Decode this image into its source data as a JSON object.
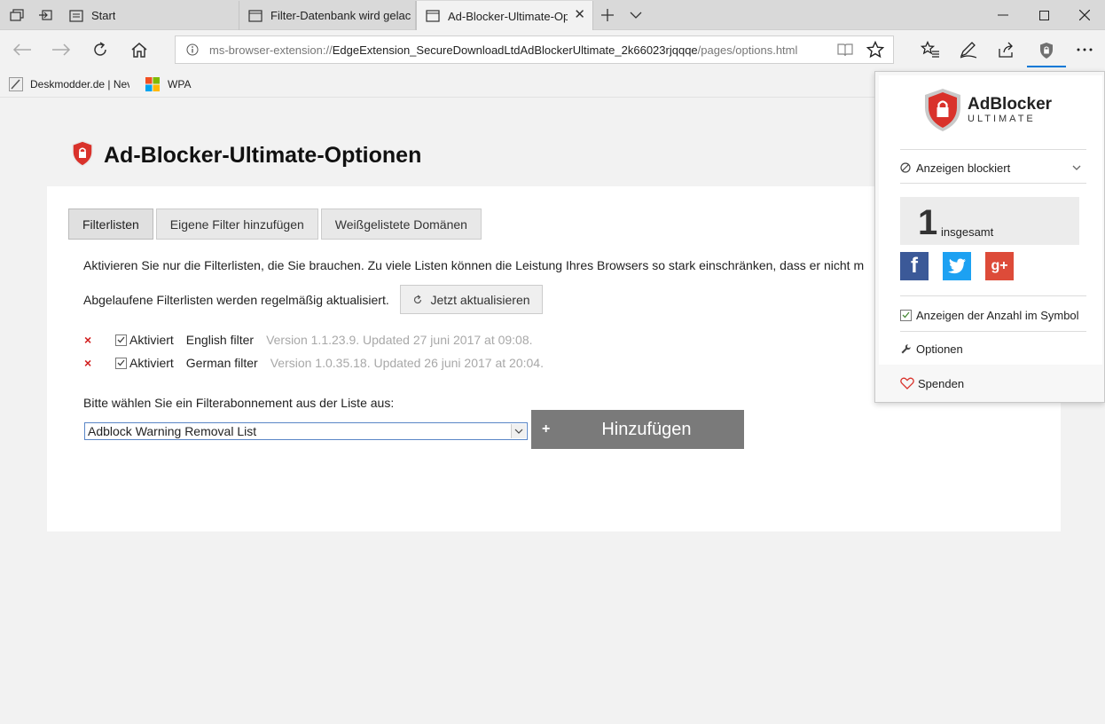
{
  "browser": {
    "tabs": [
      {
        "label": "Start"
      },
      {
        "label": "Filter-Datenbank wird gelac"
      },
      {
        "label": "Ad-Blocker-Ultimate-Op"
      }
    ],
    "address": {
      "prefix": "ms-browser-extension://",
      "host": "EdgeExtension_SecureDownloadLtdAdBlockerUltimate_2k66023rjqqqe",
      "path": "/pages/options.html"
    },
    "favorites": [
      {
        "label": "Deskmodder.de | Nev"
      },
      {
        "label": "WPA"
      }
    ]
  },
  "options": {
    "title": "Ad-Blocker-Ultimate-Optionen",
    "tabs": [
      {
        "label": "Filterlisten"
      },
      {
        "label": "Eigene Filter hinzufügen"
      },
      {
        "label": "Weißgelistete Domänen"
      }
    ],
    "intro": "Aktivieren Sie nur die Filterlisten, die Sie brauchen. Zu viele Listen können die Leistung Ihres Browsers so stark einschränken, dass er nicht m",
    "update_text": "Abgelaufene Filterlisten werden regelmäßig aktualisiert.",
    "update_button": "Jetzt aktualisieren",
    "filters": [
      {
        "remove": "×",
        "status": "Aktiviert",
        "name": "English filter",
        "version": "Version 1.1.23.9. Updated 27 juni 2017 at 09:08."
      },
      {
        "remove": "×",
        "status": "Aktiviert",
        "name": "German filter",
        "version": "Version 1.0.35.18. Updated 26 juni 2017 at 20:04."
      }
    ],
    "subscribe_label": "Bitte wählen Sie ein Filterabonnement aus der Liste aus:",
    "subscribe_selected": "Adblock Warning Removal List",
    "add_plus": "+",
    "add_button": "Hinzufügen"
  },
  "popup": {
    "brand_top": "AdBlocker",
    "brand_bottom": "ULTIMATE",
    "blocked_label": "Anzeigen blockiert",
    "count": "1",
    "count_label": "insgesamt",
    "show_count_label": "Anzeigen der Anzahl im Symbol",
    "options_label": "Optionen",
    "donate_label": "Spenden",
    "social": [
      "f",
      "g+"
    ]
  },
  "colors": {
    "accent": "#0078d7",
    "shield_red": "#d9322b",
    "facebook": "#3b5998",
    "twitter": "#1da1f2",
    "google": "#dd4b39",
    "add_button": "#7a7a7a"
  }
}
